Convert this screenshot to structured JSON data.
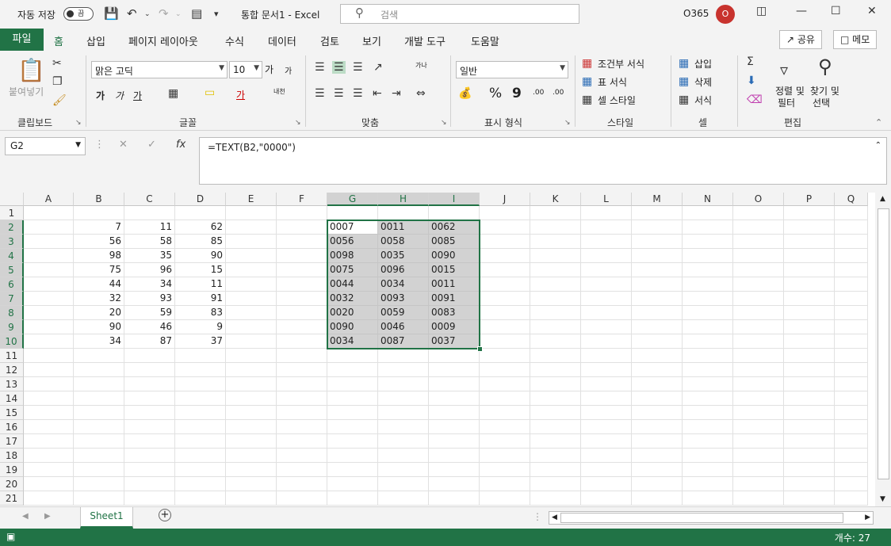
{
  "titlebar": {
    "autosave_label": "자동 저장",
    "autosave_state": "끔",
    "doc_title": "통합 문서1  -  Excel",
    "search_placeholder": "검색",
    "account": "O365",
    "avatar_initial": "O"
  },
  "tabs": {
    "file": "파일",
    "items": [
      "홈",
      "삽입",
      "페이지 레이아웃",
      "수식",
      "데이터",
      "검토",
      "보기",
      "개발 도구",
      "도움말"
    ],
    "active": "홈",
    "share": "공유",
    "comments": "메모"
  },
  "ribbon": {
    "clipboard": {
      "paste": "붙여넣기",
      "label": "클립보드"
    },
    "font": {
      "name": "맑은 고딕",
      "size": "10",
      "label": "글꼴",
      "bold": "가",
      "italic": "가",
      "underline": "가",
      "color_glyph": "가",
      "phonetic": "내천",
      "grow": "가",
      "shrink": "가"
    },
    "align": {
      "label": "맞춤",
      "wrap": "가나"
    },
    "number": {
      "format": "일반",
      "label": "표시 형식",
      "percent": "%",
      "comma": "9",
      "inc_dec": ".00",
      "dec_dec": ".00"
    },
    "styles": {
      "conditional": "조건부 서식",
      "table": "표 서식",
      "cell": "셀 스타일",
      "label": "스타일"
    },
    "cells": {
      "insert": "삽입",
      "delete": "삭제",
      "format": "서식",
      "label": "셀"
    },
    "editing": {
      "sort": "정렬 및",
      "sort2": "필터",
      "find": "찾기 및",
      "find2": "선택",
      "label": "편집"
    }
  },
  "formula_bar": {
    "name_box": "G2",
    "fx": "fx",
    "formula": "=TEXT(B2,\"0000\")"
  },
  "grid": {
    "columns": [
      "A",
      "B",
      "C",
      "D",
      "E",
      "F",
      "G",
      "H",
      "I",
      "J",
      "K",
      "L",
      "M",
      "N",
      "O",
      "P",
      "Q"
    ],
    "rows": [
      "1",
      "2",
      "3",
      "4",
      "5",
      "6",
      "7",
      "8",
      "9",
      "10",
      "11",
      "12",
      "13",
      "14",
      "15",
      "16",
      "17",
      "18",
      "19",
      "20",
      "21"
    ],
    "numbers": [
      [
        "7",
        "11",
        "62"
      ],
      [
        "56",
        "58",
        "85"
      ],
      [
        "98",
        "35",
        "90"
      ],
      [
        "75",
        "96",
        "15"
      ],
      [
        "44",
        "34",
        "11"
      ],
      [
        "32",
        "93",
        "91"
      ],
      [
        "20",
        "59",
        "83"
      ],
      [
        "90",
        "46",
        "9"
      ],
      [
        "34",
        "87",
        "37"
      ]
    ],
    "texts": [
      [
        "0007",
        "0011",
        "0062"
      ],
      [
        "0056",
        "0058",
        "0085"
      ],
      [
        "0098",
        "0035",
        "0090"
      ],
      [
        "0075",
        "0096",
        "0015"
      ],
      [
        "0044",
        "0034",
        "0011"
      ],
      [
        "0032",
        "0093",
        "0091"
      ],
      [
        "0020",
        "0059",
        "0083"
      ],
      [
        "0090",
        "0046",
        "0009"
      ],
      [
        "0034",
        "0087",
        "0037"
      ]
    ]
  },
  "sheets": {
    "active": "Sheet1",
    "add": "+"
  },
  "status": {
    "count": "개수: 27"
  },
  "colors": {
    "accent": "#217346",
    "selection": "#d2d2d2"
  }
}
